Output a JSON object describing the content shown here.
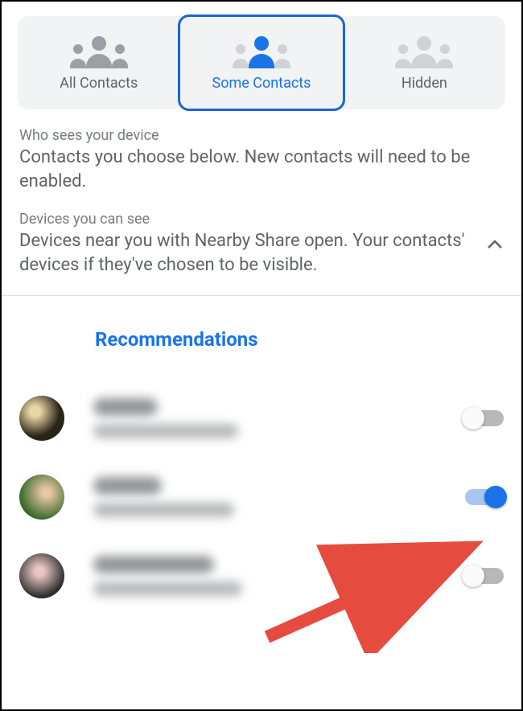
{
  "tabs": [
    {
      "label": "All Contacts",
      "selected": false
    },
    {
      "label": "Some Contacts",
      "selected": true
    },
    {
      "label": "Hidden",
      "selected": false
    }
  ],
  "info": {
    "who_title": "Who sees your device",
    "who_body": "Contacts you choose below. New contacts will need to be enabled.",
    "devices_title": "Devices you can see",
    "devices_body": "Devices near you with Nearby Share open. Your contacts' devices if they've chosen to be visible."
  },
  "section_title": "Recommendations",
  "contacts": [
    {
      "name": "(blurred)",
      "sub": "(blurred)",
      "enabled": false
    },
    {
      "name": "(blurred)",
      "sub": "(blurred)",
      "enabled": true
    },
    {
      "name": "(blurred)",
      "sub": "(blurred)",
      "enabled": false
    }
  ],
  "colors": {
    "accent": "#1a73e8"
  }
}
